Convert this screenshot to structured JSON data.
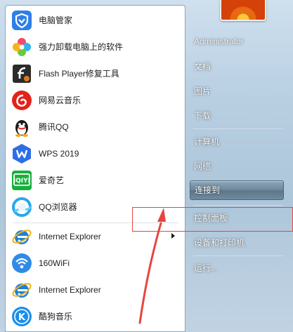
{
  "programs": [
    {
      "label": "电脑管家",
      "icon": "tencent-pc-manager-icon"
    },
    {
      "label": "强力卸载电脑上的软件",
      "icon": "uninstaller-flower-icon"
    },
    {
      "label": "Flash Player修复工具",
      "icon": "flash-player-icon"
    },
    {
      "label": "网易云音乐",
      "icon": "netease-cloud-music-icon"
    },
    {
      "label": "腾讯QQ",
      "icon": "qq-penguin-icon"
    },
    {
      "label": "WPS 2019",
      "icon": "wps-icon"
    },
    {
      "label": "爱奇艺",
      "icon": "iqiyi-icon"
    },
    {
      "label": "QQ浏览器",
      "icon": "qq-browser-icon"
    },
    {
      "label": "Internet Explorer",
      "icon": "internet-explorer-icon",
      "has_submenu": true
    },
    {
      "label": "160WiFi",
      "icon": "wifi-icon"
    },
    {
      "label": "Internet Explorer",
      "icon": "internet-explorer-icon"
    },
    {
      "label": "酷狗音乐",
      "icon": "kugou-music-icon"
    }
  ],
  "right_menu": {
    "user": "Administrator",
    "items": [
      "文档",
      "图片",
      "下载",
      "计算机",
      "网络",
      "连接到",
      "控制面板",
      "设备和打印机",
      "运行..."
    ],
    "highlighted": "连接到"
  },
  "annotation": {
    "color": "#e6453e",
    "target": "控制面板"
  }
}
